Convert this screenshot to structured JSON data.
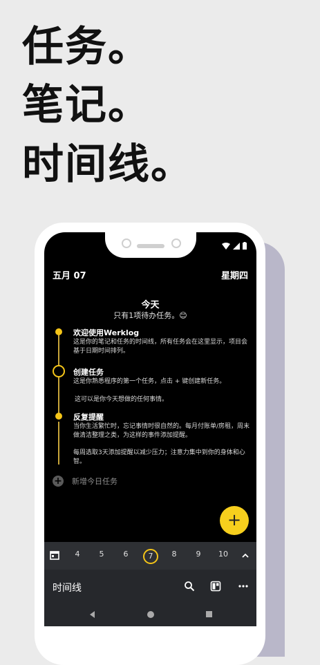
{
  "headline": [
    "任务。",
    "笔记。",
    "时间线。"
  ],
  "header": {
    "date": "五月 07",
    "weekday": "星期四"
  },
  "today": {
    "title": "今天",
    "subtitle": "只有1项待办任务。😊"
  },
  "items": [
    {
      "title": "欢迎使用Werklog",
      "desc": "这是你的笔记和任务的时间线，所有任务会在这里显示，项目会基于日期时间排列。"
    },
    {
      "title": "创建任务",
      "desc": "这是你熟悉程序的第一个任务，点击 + 键创建新任务。",
      "desc2": "这可以是你今天想做的任何事情。"
    },
    {
      "title": "反复提醒",
      "desc": "当你生活繁忙时，忘记事情时很自然的。每月付账单/房租，周末做清洁整理之类，为这样的事件添加提醒。",
      "desc2": "每周选取3天添加提醒以减少压力；注意力集中到你的身体和心智。"
    }
  ],
  "add_today": "新增今日任务",
  "fab": "+",
  "datebar": {
    "days": [
      "4",
      "5",
      "6",
      "7",
      "8",
      "9",
      "10"
    ],
    "selected": "7"
  },
  "toolbar": {
    "title": "时间线"
  },
  "colors": {
    "accent": "#f5c518",
    "screen_bg": "#000000",
    "bottom_bg": "#26282c"
  }
}
